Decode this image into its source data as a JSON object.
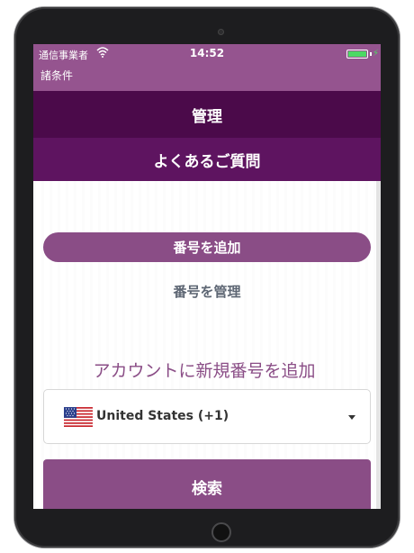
{
  "status_bar": {
    "carrier": "通信事業者",
    "time": "14:52",
    "battery_level": 1.0
  },
  "nav": {
    "back_label": "諸条件"
  },
  "menu": {
    "manage_label": "管理",
    "faq_label": "よくあるご質問"
  },
  "tabs": {
    "add_number_label": "番号を追加",
    "manage_numbers_label": "番号を管理"
  },
  "form": {
    "title": "アカウントに新規番号を追加",
    "country_value": "United States (+1)",
    "search_label": "検索"
  },
  "icons": [
    "wifi-icon",
    "battery-icon",
    "charging-icon",
    "us-flag-icon",
    "chevron-down-icon"
  ],
  "colors": {
    "status_bar": "#95548f",
    "menu_manage": "#4b0a4a",
    "menu_faq": "#5e1460",
    "accent": "#8a4d86",
    "tab_inactive_text": "#5d6673",
    "battery": "#4cd964"
  }
}
